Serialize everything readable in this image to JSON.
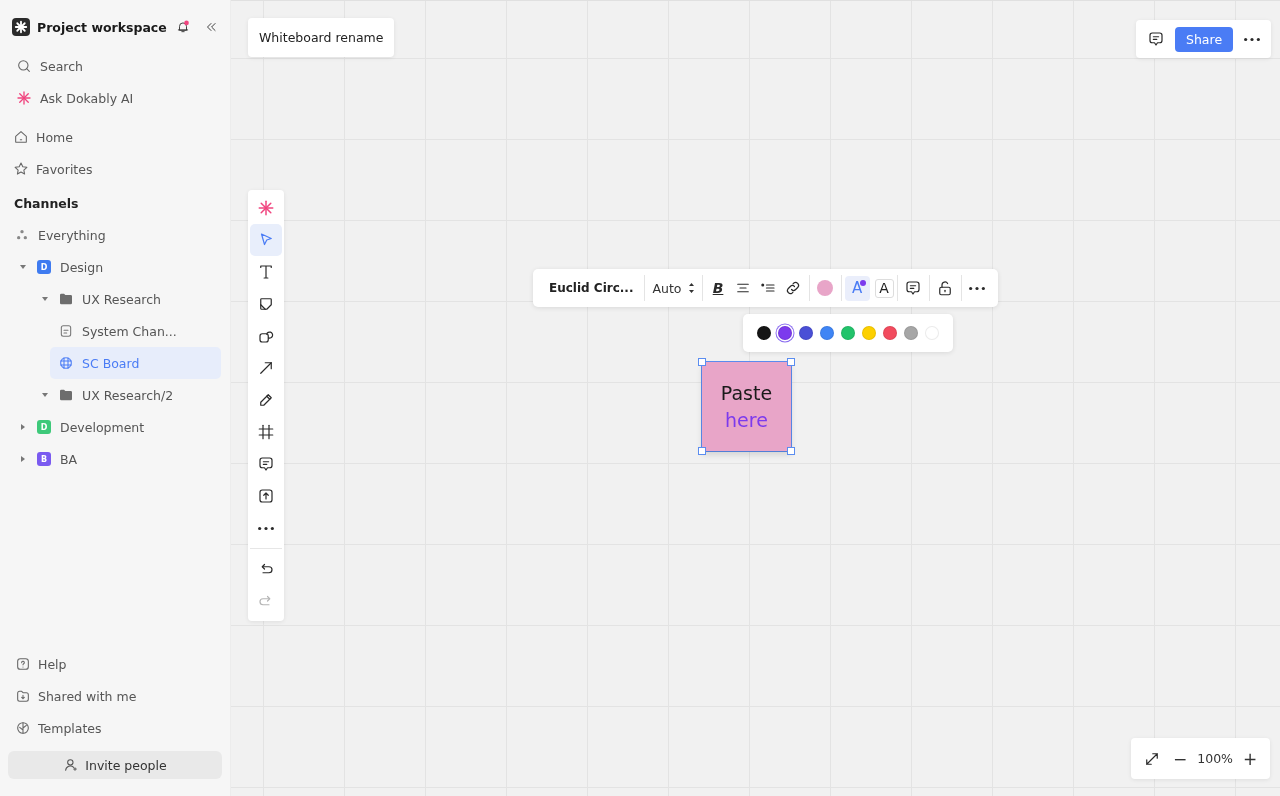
{
  "sidebar": {
    "workspace": "Project workspace",
    "notification_badge": true,
    "nav": [
      {
        "kind": "search",
        "label": "Search"
      },
      {
        "kind": "ai",
        "label": "Ask Dokably AI"
      },
      {
        "kind": "home",
        "label": "Home"
      },
      {
        "kind": "star",
        "label": "Favorites"
      }
    ],
    "channels_heading": "Channels",
    "tree": [
      {
        "kind": "dots",
        "label": "Everything",
        "selected": false
      },
      {
        "kind": "badge",
        "badge": "D",
        "color": "#3f7bf0",
        "label": "Design",
        "expanded": true,
        "selected": false,
        "children": [
          {
            "kind": "folder",
            "label": "UX Research",
            "expanded": true,
            "selected": false,
            "children": [
              {
                "kind": "doc",
                "label": "System Chan...",
                "selected": false
              },
              {
                "kind": "board",
                "label": "SC Board",
                "selected": true
              }
            ]
          },
          {
            "kind": "folder",
            "label": "UX Research/2",
            "expanded": true,
            "selected": false
          }
        ]
      },
      {
        "kind": "badge",
        "badge": "D",
        "color": "#3ec97a",
        "label": "Development",
        "expanded": false,
        "selected": false
      },
      {
        "kind": "badge",
        "badge": "B",
        "color": "#7a5af0",
        "label": "BA",
        "expanded": false,
        "selected": false
      }
    ],
    "footer": [
      {
        "kind": "help",
        "label": "Help"
      },
      {
        "kind": "shared",
        "label": "Shared with me"
      },
      {
        "kind": "templates",
        "label": "Templates"
      }
    ],
    "invite_button": "Invite people"
  },
  "canvas": {
    "board_title": "Whiteboard rename",
    "tools": [
      {
        "kind": "ai",
        "selected": false,
        "disabled": false
      },
      {
        "kind": "select",
        "selected": true,
        "disabled": false
      },
      {
        "kind": "text",
        "selected": false,
        "disabled": false
      },
      {
        "kind": "sticky",
        "selected": false,
        "disabled": false
      },
      {
        "kind": "shape",
        "selected": false,
        "disabled": false
      },
      {
        "kind": "arrow",
        "selected": false,
        "disabled": false
      },
      {
        "kind": "pen",
        "selected": false,
        "disabled": false
      },
      {
        "kind": "frame",
        "selected": false,
        "disabled": false
      },
      {
        "kind": "comment",
        "selected": false,
        "disabled": false
      },
      {
        "kind": "upload",
        "selected": false,
        "disabled": false
      },
      {
        "kind": "more",
        "selected": false,
        "disabled": false
      },
      {
        "kind": "undo",
        "selected": false,
        "disabled": false
      },
      {
        "kind": "redo",
        "selected": false,
        "disabled": true
      }
    ],
    "text_toolbar": [
      [
        {
          "kind": "font",
          "label": "Euclid Circ..."
        }
      ],
      [
        {
          "kind": "size",
          "label": "Auto"
        }
      ],
      [
        {
          "kind": "bold",
          "label": "B"
        },
        {
          "kind": "align"
        },
        {
          "kind": "list"
        },
        {
          "kind": "link"
        }
      ],
      [
        {
          "kind": "fill",
          "color": "#e8a5c8"
        }
      ],
      [
        {
          "kind": "text_color",
          "label": "A",
          "color": "#7c3aed",
          "selected": true
        },
        {
          "kind": "text_style",
          "label": "A",
          "selected": false
        }
      ],
      [
        {
          "kind": "comment"
        }
      ],
      [
        {
          "kind": "lock"
        }
      ],
      [
        {
          "kind": "more"
        }
      ]
    ],
    "palette": [
      {
        "color": "#151515",
        "selected": false
      },
      {
        "color": "#7c3aed",
        "selected": true
      },
      {
        "color": "#4a4fd6",
        "selected": false
      },
      {
        "color": "#3f85f5",
        "selected": false
      },
      {
        "color": "#22c36b",
        "selected": false
      },
      {
        "color": "#fdd000",
        "selected": false
      },
      {
        "color": "#f24b5e",
        "selected": false
      },
      {
        "color": "#a6a6a6",
        "selected": false
      },
      {
        "color": "#ffffff",
        "selected": false
      }
    ],
    "sticky": {
      "color": "#e8a5c8",
      "selected": true,
      "lines": [
        {
          "text": "Paste",
          "color": "#1a1a1a"
        },
        {
          "text": "here",
          "color": "#7c3aed"
        }
      ]
    },
    "share_button": "Share",
    "zoom": {
      "minus": "−",
      "level": "100%",
      "plus": "+"
    }
  }
}
